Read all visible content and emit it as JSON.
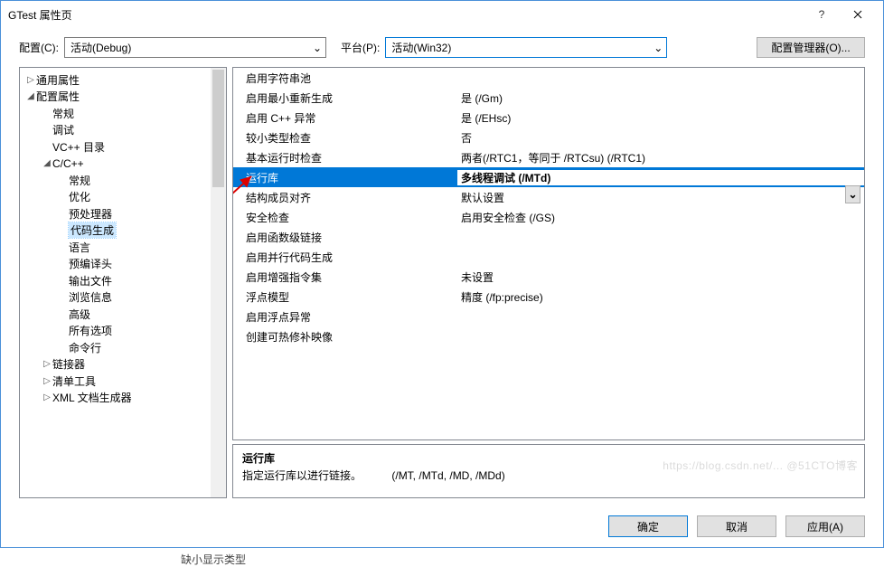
{
  "window": {
    "title": "GTest 属性页"
  },
  "toolbar": {
    "config_label": "配置(C):",
    "config_value": "活动(Debug)",
    "platform_label": "平台(P):",
    "platform_value": "活动(Win32)",
    "manager_button": "配置管理器(O)..."
  },
  "tree": [
    {
      "level": 0,
      "expand": "▷",
      "label": "通用属性"
    },
    {
      "level": 0,
      "expand": "◢",
      "label": "配置属性"
    },
    {
      "level": 1,
      "expand": "",
      "label": "常规"
    },
    {
      "level": 1,
      "expand": "",
      "label": "调试"
    },
    {
      "level": 1,
      "expand": "",
      "label": "VC++ 目录"
    },
    {
      "level": 1,
      "expand": "◢",
      "label": "C/C++"
    },
    {
      "level": 2,
      "expand": "",
      "label": "常规"
    },
    {
      "level": 2,
      "expand": "",
      "label": "优化"
    },
    {
      "level": 2,
      "expand": "",
      "label": "预处理器"
    },
    {
      "level": 2,
      "expand": "",
      "label": "代码生成",
      "selected": true
    },
    {
      "level": 2,
      "expand": "",
      "label": "语言"
    },
    {
      "level": 2,
      "expand": "",
      "label": "预编译头"
    },
    {
      "level": 2,
      "expand": "",
      "label": "输出文件"
    },
    {
      "level": 2,
      "expand": "",
      "label": "浏览信息"
    },
    {
      "level": 2,
      "expand": "",
      "label": "高级"
    },
    {
      "level": 2,
      "expand": "",
      "label": "所有选项"
    },
    {
      "level": 2,
      "expand": "",
      "label": "命令行"
    },
    {
      "level": 1,
      "expand": "▷",
      "label": "链接器"
    },
    {
      "level": 1,
      "expand": "▷",
      "label": "清单工具"
    },
    {
      "level": 1,
      "expand": "▷",
      "label": "XML 文档生成器"
    }
  ],
  "grid": [
    {
      "k": "启用字符串池",
      "v": ""
    },
    {
      "k": "启用最小重新生成",
      "v": "是 (/Gm)"
    },
    {
      "k": "启用 C++ 异常",
      "v": "是 (/EHsc)"
    },
    {
      "k": "较小类型检查",
      "v": "否"
    },
    {
      "k": "基本运行时检查",
      "v": "两者(/RTC1，等同于 /RTCsu) (/RTC1)"
    },
    {
      "k": "运行库",
      "v": "多线程调试 (/MTd)",
      "selected": true
    },
    {
      "k": "结构成员对齐",
      "v": "默认设置"
    },
    {
      "k": "安全检查",
      "v": "启用安全检查 (/GS)"
    },
    {
      "k": "启用函数级链接",
      "v": ""
    },
    {
      "k": "启用并行代码生成",
      "v": ""
    },
    {
      "k": "启用增强指令集",
      "v": "未设置"
    },
    {
      "k": "浮点模型",
      "v": "精度 (/fp:precise)"
    },
    {
      "k": "启用浮点异常",
      "v": ""
    },
    {
      "k": "创建可热修补映像",
      "v": ""
    }
  ],
  "desc": {
    "title": "运行库",
    "text": "指定运行库以进行链接。",
    "flags": "(/MT, /MTd, /MD, /MDd)"
  },
  "footer": {
    "ok": "确定",
    "cancel": "取消",
    "apply": "应用(A)"
  },
  "truncated": "缺小显示类型"
}
